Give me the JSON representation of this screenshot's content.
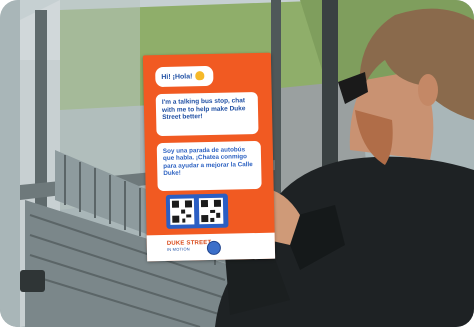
{
  "poster": {
    "greeting": "Hi! ¡Hola!",
    "english_text": "I'm a talking bus stop, chat with me to help make Duke Street better!",
    "spanish_text": "Soy una parada de autobús que habla. ¡Chatea conmigo para ayudar a mejorar la Calle Duke!",
    "logo_text": "DUKE STREET",
    "logo_subtext": "IN MOTION",
    "colors": {
      "poster_orange": "#f15a22",
      "bubble_text_blue": "#1f4fa3",
      "qr_panel_blue": "#2a5ec4"
    }
  },
  "scene": {
    "icons": [
      "phone-icon",
      "qr-code-icon",
      "bench-icon",
      "seal-icon",
      "wave-hand-icon"
    ]
  }
}
